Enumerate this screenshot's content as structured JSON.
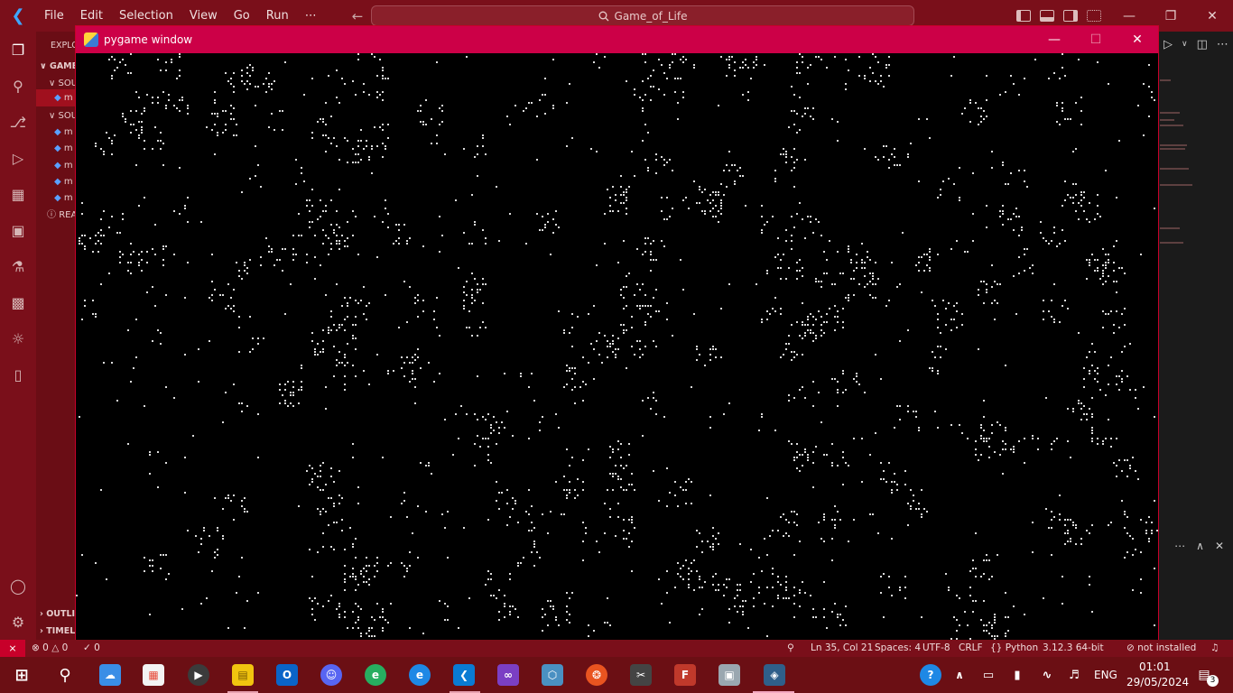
{
  "titlebar": {
    "menu": [
      "File",
      "Edit",
      "Selection",
      "View",
      "Go",
      "Run",
      "⋯"
    ],
    "search_text": "Game_of_Life",
    "back_glyph": "←",
    "forward_glyph": "→",
    "window_controls": [
      "—",
      "❐",
      "✕"
    ]
  },
  "sidebar": {
    "header": "EXPLO",
    "section": "GAME",
    "folder1": "SOU",
    "file_active": "m",
    "folder2": "SOU",
    "files": [
      "m",
      "m",
      "m",
      "m",
      "m"
    ],
    "readme": "REA",
    "outline": "OUTLI",
    "timeline": "TIMEL"
  },
  "pygame": {
    "title": "pygame window",
    "controls": [
      "—",
      "☐",
      "✕"
    ]
  },
  "statusbar": {
    "errors": "0",
    "warnings": "0",
    "ports": "0",
    "position": "Ln 35, Col 21",
    "spaces": "Spaces: 4",
    "encoding": "UTF-8",
    "eol": "CRLF",
    "language": "Python",
    "interpreter": "3.12.3 64-bit",
    "lint": "not installed"
  },
  "taskbar": {
    "language": "ENG",
    "time": "01:01",
    "date": "29/05/2024",
    "notifications": "3"
  },
  "colors": {
    "theme_red": "#7a0f1a",
    "pygame_title": "#cc0047",
    "cell": "#dcdcdc"
  }
}
